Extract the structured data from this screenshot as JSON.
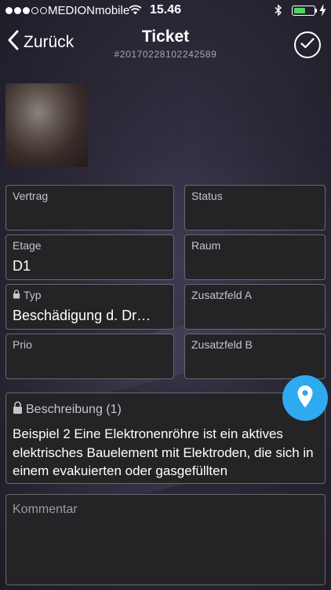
{
  "statusbar": {
    "carrier": "MEDIONmobile",
    "time": "15.46",
    "battery_level": 0.6,
    "signal_bars_filled": 3,
    "signal_bars_total": 5,
    "battery_color": "#4cd964"
  },
  "nav": {
    "back_label": "Zurück",
    "title": "Ticket",
    "subtitle": "#20170228102242589",
    "confirm_icon": "checkmark-circle-icon"
  },
  "photos": [
    {
      "name": "photo-1"
    },
    {
      "name": "photo-2"
    },
    {
      "name": "photo-3"
    },
    {
      "name": "photo-4"
    }
  ],
  "fields": {
    "vertrag": {
      "label": "Vertrag",
      "value": ""
    },
    "status": {
      "label": "Status",
      "value": ""
    },
    "etage": {
      "label": "Etage",
      "value": "D1"
    },
    "raum": {
      "label": "Raum",
      "value": ""
    },
    "typ": {
      "label": "Typ",
      "value": "Beschädigung d. Dr…",
      "locked": true
    },
    "zusatzfeld_a": {
      "label": "Zusatzfeld A",
      "value": ""
    },
    "prio": {
      "label": "Prio",
      "value": ""
    },
    "zusatzfeld_b": {
      "label": "Zusatzfeld B",
      "value": ""
    }
  },
  "beschreibung": {
    "label": "Beschreibung (1)",
    "locked": true,
    "text": "Beispiel 2 Eine Elektronenröhre ist ein aktives elektrisches Bauelement mit Elektroden, die sich in einem evakuierten oder gasgefüllten"
  },
  "kommentar": {
    "placeholder": "Kommentar"
  },
  "location_button": {
    "icon": "location-pin-icon",
    "color": "#2eaaf0"
  }
}
